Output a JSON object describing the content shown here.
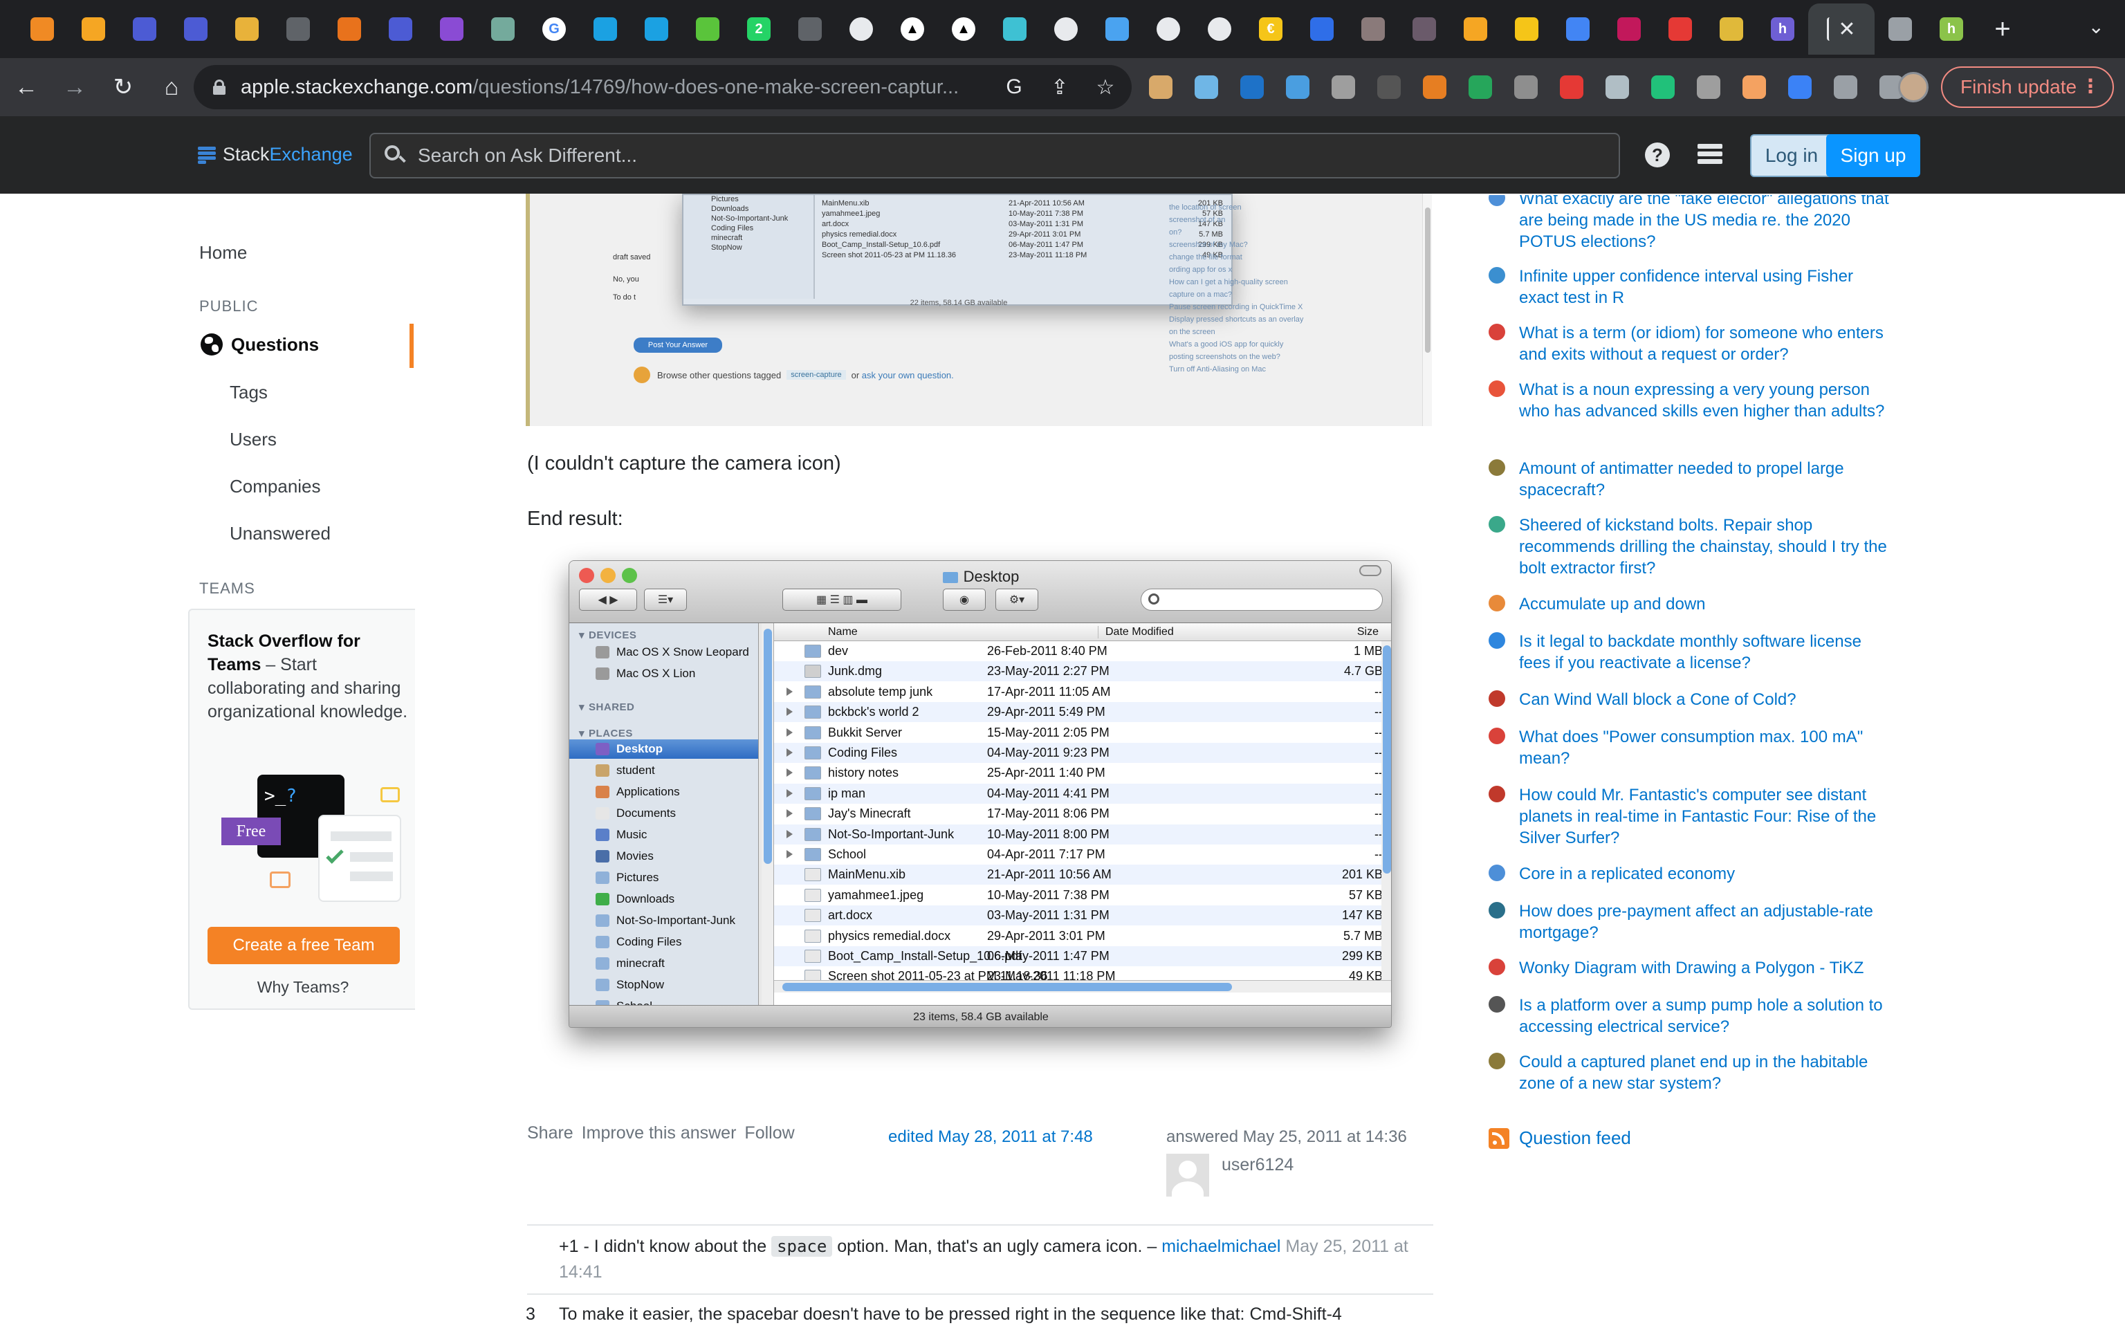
{
  "browser": {
    "tabs": [
      {
        "icon": "hex-orange-icon",
        "color": "#f08a24",
        "glyph": ""
      },
      {
        "icon": "hex-orange-icon",
        "color": "#f5a623",
        "glyph": ""
      },
      {
        "icon": "grid-icon",
        "color": "#4c5bd4",
        "glyph": ""
      },
      {
        "icon": "grid-icon",
        "color": "#4c5bd4",
        "glyph": ""
      },
      {
        "icon": "box-icon",
        "color": "#e8b23a",
        "glyph": ""
      },
      {
        "icon": "globe-icon",
        "color": "#5f6368",
        "glyph": ""
      },
      {
        "icon": "rss-icon",
        "color": "#e8721c",
        "glyph": ""
      },
      {
        "icon": "grid-icon",
        "color": "#4c5bd4",
        "glyph": ""
      },
      {
        "icon": "link-icon",
        "color": "#8a4bd4",
        "glyph": ""
      },
      {
        "icon": "chatgpt-icon",
        "color": "#74aa9c",
        "glyph": ""
      },
      {
        "icon": "google-icon",
        "color": "#ffffff",
        "glyph": "G"
      },
      {
        "icon": "heart-icon",
        "color": "#1ba1e2",
        "glyph": ""
      },
      {
        "icon": "heart-icon",
        "color": "#1ba1e2",
        "glyph": ""
      },
      {
        "icon": "circle-green-icon",
        "color": "#5ac43b",
        "glyph": ""
      },
      {
        "icon": "whatsapp-icon",
        "color": "#25d366",
        "glyph": "2"
      },
      {
        "icon": "globe-icon",
        "color": "#5f6368",
        "glyph": ""
      },
      {
        "icon": "github-icon",
        "color": "#e8eaed",
        "glyph": ""
      },
      {
        "icon": "triangle-icon",
        "color": "#000000",
        "glyph": "▲"
      },
      {
        "icon": "triangle-icon",
        "color": "#000000",
        "glyph": "▲"
      },
      {
        "icon": "slash-icon",
        "color": "#3ec1d3",
        "glyph": ""
      },
      {
        "icon": "github-icon",
        "color": "#e8eaed",
        "glyph": ""
      },
      {
        "icon": "diamond-icon",
        "color": "#4aa3f0",
        "glyph": ""
      },
      {
        "icon": "github-icon",
        "color": "#e8eaed",
        "glyph": ""
      },
      {
        "icon": "github-icon",
        "color": "#e8eaed",
        "glyph": ""
      },
      {
        "icon": "coin-icon",
        "color": "#f5c518",
        "glyph": "€"
      },
      {
        "icon": "messenger-icon",
        "color": "#2f6ee8",
        "glyph": ""
      },
      {
        "icon": "avatar-icon",
        "color": "#8a7a7a",
        "glyph": ""
      },
      {
        "icon": "avatar-icon",
        "color": "#6a5a6a",
        "glyph": ""
      },
      {
        "icon": "chart-icon",
        "color": "#f5a623",
        "glyph": ""
      },
      {
        "icon": "stripes-icon",
        "color": "#f5c518",
        "glyph": ""
      },
      {
        "icon": "docs-icon",
        "color": "#4285f4",
        "glyph": ""
      },
      {
        "icon": "flag-icon",
        "color": "#c2185b",
        "glyph": ""
      },
      {
        "icon": "adobe-icon",
        "color": "#e53935",
        "glyph": ""
      },
      {
        "icon": "crown-icon",
        "color": "#e0b93a",
        "glyph": ""
      },
      {
        "icon": "h-icon",
        "color": "#6e5fd4",
        "glyph": "h"
      },
      {
        "icon": "stackexchange-icon",
        "color": "#1f2023",
        "glyph": "",
        "active": true
      },
      {
        "icon": "car-icon",
        "color": "#9aa0a6",
        "glyph": ""
      },
      {
        "icon": "h-icon",
        "color": "#8bc34a",
        "glyph": "h"
      }
    ],
    "url_host": "apple.stackexchange.com",
    "url_path": "/questions/14769/how-does-one-make-screen-captur...",
    "finish_update": "Finish update",
    "extensions": [
      "#d8a96a",
      "#6fb6e6",
      "#1e72c8",
      "#4a9ee0",
      "#9e9e9e",
      "#555555",
      "#e67e22",
      "#26a65b",
      "#8e8e8e",
      "#e53935",
      "#b0bec5",
      "#21c17a",
      "#9e9e9e",
      "#f4a261",
      "#3b82f6",
      "#9aa0a6",
      "#9aa0a6"
    ]
  },
  "se": {
    "logo_stack": "Stack",
    "logo_exchange": "Exchange",
    "search_placeholder": "Search on Ask Different...",
    "login": "Log in",
    "signup": "Sign up"
  },
  "sidebar": {
    "home": "Home",
    "public": "PUBLIC",
    "questions": "Questions",
    "tags": "Tags",
    "users": "Users",
    "companies": "Companies",
    "unanswered": "Unanswered",
    "teams": "TEAMS",
    "teams_title": "Stack Overflow for Teams",
    "teams_body": " – Start collaborating and sharing organizational knowledge.",
    "free": "Free",
    "terminal": ">_",
    "terminal_q": "?",
    "create_team": "Create a free Team",
    "why_teams": "Why Teams?"
  },
  "main": {
    "top_shot": {
      "finder_rows": [
        [
          "MainMenu.xib",
          "21-Apr-2011 10:56 AM",
          "201 KB"
        ],
        [
          "yamahmee1.jpeg",
          "10-May-2011 7:38 PM",
          "57 KB"
        ],
        [
          "art.docx",
          "03-May-2011 1:31 PM",
          "147 KB"
        ],
        [
          "physics remedial.docx",
          "29-Apr-2011 3:01 PM",
          "5.7 MB"
        ],
        [
          "Boot_Camp_Install-Setup_10.6.pdf",
          "06-May-2011 1:47 PM",
          "299 KB"
        ],
        [
          "Screen shot 2011-05-23 at PM 11.18.36",
          "23-May-2011 11:18 PM",
          "49 KB"
        ]
      ],
      "finder_side": [
        "Pictures",
        "Downloads",
        "Not-So-Important-Junk",
        "Coding Files",
        "minecraft",
        "StopNow"
      ],
      "finder_status": "22 items, 58.14 GB available",
      "post_btn": "Post Your Answer",
      "browse_text": "Browse other questions tagged",
      "tag": "screen-capture",
      "or": "or",
      "ask": "ask your own question.",
      "related": [
        "the location of screen",
        "screenshot of an",
        "on?",
        "screenshot of my Mac?",
        "change the file format",
        "ording app for os x",
        "How can I get a high-quality screen",
        "capture on a mac?",
        "Pause screen recording in QuickTime X",
        "Display pressed shortcuts as an overlay",
        "on the screen",
        "What's a good iOS app for quickly",
        "posting screenshots on the web?",
        "Turn off Anti-Aliasing on Mac"
      ]
    },
    "p1": "(I couldn't capture the camera icon)",
    "p2": "End result:",
    "finder": {
      "title": "Desktop",
      "sections": {
        "devices": "DEVICES",
        "shared": "SHARED",
        "places": "PLACES"
      },
      "devices": [
        {
          "name": "Mac OS X Snow Leopard",
          "color": "#9a9a9a"
        },
        {
          "name": "Mac OS X Lion",
          "color": "#9a9a9a"
        }
      ],
      "places": [
        {
          "name": "Desktop",
          "color": "#7d5fc4",
          "selected": true
        },
        {
          "name": "student",
          "color": "#c9a46a"
        },
        {
          "name": "Applications",
          "color": "#d9824a"
        },
        {
          "name": "Documents",
          "color": "#e6e6e6"
        },
        {
          "name": "Music",
          "color": "#5a7fc9"
        },
        {
          "name": "Movies",
          "color": "#4a6ea8"
        },
        {
          "name": "Pictures",
          "color": "#8fb1d9"
        },
        {
          "name": "Downloads",
          "color": "#3fae49"
        },
        {
          "name": "Not-So-Important-Junk",
          "color": "#8fb1d9"
        },
        {
          "name": "Coding Files",
          "color": "#8fb1d9"
        },
        {
          "name": "minecraft",
          "color": "#8fb1d9"
        },
        {
          "name": "StopNow",
          "color": "#8fb1d9"
        },
        {
          "name": "School",
          "color": "#8fb1d9"
        }
      ],
      "columns": {
        "name": "Name",
        "date": "Date Modified",
        "size": "Size"
      },
      "rows": [
        {
          "name": "dev",
          "date": "26-Feb-2011 8:40 PM",
          "size": "1 MB",
          "folder": false,
          "color": "#8fb1d9"
        },
        {
          "name": "Junk.dmg",
          "date": "23-May-2011 2:27 PM",
          "size": "4.7 GB",
          "folder": false,
          "color": "#cfcfcf"
        },
        {
          "name": "absolute temp junk",
          "date": "17-Apr-2011 11:05 AM",
          "size": "--",
          "folder": true,
          "color": "#8fb1d9"
        },
        {
          "name": "bckbck's world 2",
          "date": "29-Apr-2011 5:49 PM",
          "size": "--",
          "folder": true,
          "color": "#8fb1d9"
        },
        {
          "name": "Bukkit Server",
          "date": "15-May-2011 2:05 PM",
          "size": "--",
          "folder": true,
          "color": "#8fb1d9"
        },
        {
          "name": "Coding Files",
          "date": "04-May-2011 9:23 PM",
          "size": "--",
          "folder": true,
          "color": "#8fb1d9"
        },
        {
          "name": "history notes",
          "date": "25-Apr-2011 1:40 PM",
          "size": "--",
          "folder": true,
          "color": "#8fb1d9"
        },
        {
          "name": "ip man",
          "date": "04-May-2011 4:41 PM",
          "size": "--",
          "folder": true,
          "color": "#8fb1d9"
        },
        {
          "name": "Jay's Minecraft",
          "date": "17-May-2011 8:06 PM",
          "size": "--",
          "folder": true,
          "color": "#8fb1d9"
        },
        {
          "name": "Not-So-Important-Junk",
          "date": "10-May-2011 8:00 PM",
          "size": "--",
          "folder": true,
          "color": "#8fb1d9"
        },
        {
          "name": "School",
          "date": "04-Apr-2011 7:17 PM",
          "size": "--",
          "folder": true,
          "color": "#8fb1d9"
        },
        {
          "name": "MainMenu.xib",
          "date": "21-Apr-2011 10:56 AM",
          "size": "201 KB",
          "folder": false,
          "color": "#e8e8e8"
        },
        {
          "name": "yamahmee1.jpeg",
          "date": "10-May-2011 7:38 PM",
          "size": "57 KB",
          "folder": false,
          "color": "#e8e8e8"
        },
        {
          "name": "art.docx",
          "date": "03-May-2011 1:31 PM",
          "size": "147 KB",
          "folder": false,
          "color": "#e8e8e8"
        },
        {
          "name": "physics remedial.docx",
          "date": "29-Apr-2011 3:01 PM",
          "size": "5.7 MB",
          "folder": false,
          "color": "#e8e8e8"
        },
        {
          "name": "Boot_Camp_Install-Setup_10.6.pdf",
          "date": "06-May-2011 1:47 PM",
          "size": "299 KB",
          "folder": false,
          "color": "#e8e8e8"
        },
        {
          "name": "Screen shot 2011-05-23 at PM 11.18.36",
          "date": "23-May-2011 11:18 PM",
          "size": "49 KB",
          "folder": false,
          "color": "#e8e8e8"
        }
      ],
      "status": "23 items, 58.4 GB available"
    },
    "share": "Share",
    "improve": "Improve this answer",
    "follow": "Follow",
    "edited": "edited May 28, 2011 at 7:48",
    "answered": "answered May 25, 2011 at 14:36",
    "user": "user6124",
    "comment1": {
      "pre": "+1 - I didn't know about the ",
      "code": "space",
      "post": " option. Man, that's an ugly camera icon. – ",
      "user": "michaelmichael",
      "date": " May 25, 2011 at 14:41"
    },
    "comment2": {
      "score": "3",
      "text": "To make it easier, the spacebar doesn't have to be pressed right in the sequence like that: Cmd-Shift-4"
    }
  },
  "hot": [
    {
      "title": "What exactly are the \"fake elector\" allegations that are being made in the US media re. the 2020 POTUS elections?",
      "icon": "politics-icon",
      "color": "#4d8fd8"
    },
    {
      "title": "Infinite upper confidence interval using Fisher exact test in R",
      "icon": "stats-icon",
      "color": "#3b8fd0"
    },
    {
      "title": "What is a term (or idiom) for someone who enters and exits without a request or order?",
      "icon": "english-icon",
      "color": "#d9423a"
    },
    {
      "title": "What is a noun expressing a very young person who has advanced skills even higher than adults?",
      "icon": "ell-icon",
      "color": "#e8533a"
    },
    {
      "title": "Amount of antimatter needed to propel large spacecraft?",
      "icon": "worldbuilding-icon",
      "color": "#8b7a3a"
    },
    {
      "title": "Sheered of kickstand bolts. Repair shop recommends drilling the chainstay, should I try the bolt extractor first?",
      "icon": "bicycles-icon",
      "color": "#3aa88a"
    },
    {
      "title": "Accumulate up and down",
      "icon": "codegolf-icon",
      "color": "#e88a3a"
    },
    {
      "title": "Is it legal to backdate monthly software license fees if you reactivate a license?",
      "icon": "law-icon",
      "color": "#2e86de"
    },
    {
      "title": "Can Wind Wall block a Cone of Cold?",
      "icon": "rpg-icon",
      "color": "#c0392b"
    },
    {
      "title": "What does \"Power consumption max. 100 mA\" mean?",
      "icon": "electronics-icon",
      "color": "#d9423a"
    },
    {
      "title": "How could Mr. Fantastic's computer see distant planets in real-time in Fantastic Four: Rise of the Silver Surfer?",
      "icon": "scifi-icon",
      "color": "#c0392b"
    },
    {
      "title": "Core in a replicated economy",
      "icon": "economics-icon",
      "color": "#4d8fd8"
    },
    {
      "title": "How does pre-payment affect an adjustable-rate mortgage?",
      "icon": "money-icon",
      "color": "#2a6f8a"
    },
    {
      "title": "Wonky Diagram with Drawing a Polygon - TiKZ",
      "icon": "tex-icon",
      "color": "#d9423a"
    },
    {
      "title": "Is a platform over a sump pump hole a solution to accessing electrical service?",
      "icon": "diy-icon",
      "color": "#555555"
    },
    {
      "title": "Could a captured planet end up in the habitable zone of a new star system?",
      "icon": "worldbuilding-icon",
      "color": "#8b7a3a"
    }
  ],
  "question_feed": "Question feed"
}
